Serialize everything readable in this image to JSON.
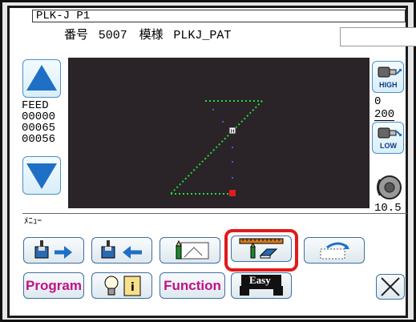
{
  "header": {
    "program_id": "PLK-J P1",
    "number_label": "番号",
    "number_value": "5007",
    "pattern_label": "模様",
    "pattern_value": "PLKJ_PAT"
  },
  "feed": {
    "label": "FEED",
    "values": [
      "00000",
      "00065",
      "00056"
    ]
  },
  "speed": {
    "high_label": "HIGH",
    "low_label": "LOW",
    "value_top": "0",
    "value_bottom": "200"
  },
  "tension_value": "10.5",
  "menu_label": "ﾒﾆｭｰ",
  "buttons": {
    "program": "Program",
    "function": "Function",
    "easy": "Easy"
  },
  "colors": {
    "canvas_bg": "#2a2328",
    "stitch_green": "#22dd33",
    "highlight_red": "#e11a1a",
    "arrow_blue": "#1f6fc6"
  }
}
